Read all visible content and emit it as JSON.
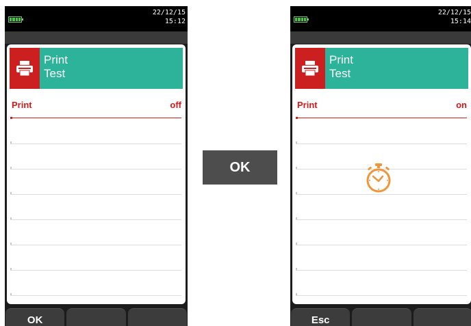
{
  "colors": {
    "accent": "#2db39a",
    "icon_bg": "#cc1f1f",
    "value_red": "#d11a1a",
    "timer": "#f0953a"
  },
  "left": {
    "status": {
      "date": "22/12/15",
      "time": "15:12"
    },
    "header": {
      "line1": "Print",
      "line2": "Test",
      "icon": "printer-icon"
    },
    "row": {
      "label": "Print",
      "value": "off"
    },
    "softkeys": [
      "OK",
      "",
      ""
    ]
  },
  "middle_button": {
    "label": "OK"
  },
  "right": {
    "status": {
      "date": "22/12/15",
      "time": "15:14"
    },
    "header": {
      "line1": "Print",
      "line2": "Test",
      "icon": "printer-icon"
    },
    "row": {
      "label": "Print",
      "value": "on"
    },
    "busy_icon": "stopwatch-icon",
    "softkeys": [
      "Esc",
      "",
      ""
    ]
  }
}
